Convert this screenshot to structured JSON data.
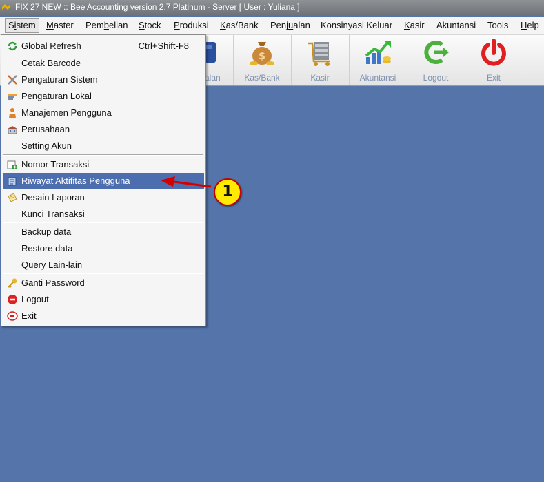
{
  "window": {
    "title": "FIX 27 NEW :: Bee Accounting version 2.7 Platinum - Server  [ User : Yuliana ]"
  },
  "menubar": {
    "items": [
      {
        "pre": "S",
        "u": "i",
        "post": "stem"
      },
      {
        "pre": "",
        "u": "M",
        "post": "aster"
      },
      {
        "pre": "Pem",
        "u": "b",
        "post": "elian"
      },
      {
        "pre": "",
        "u": "S",
        "post": "tock"
      },
      {
        "pre": "",
        "u": "P",
        "post": "roduksi"
      },
      {
        "pre": "",
        "u": "K",
        "post": "as/Bank"
      },
      {
        "pre": "Penj",
        "u": "u",
        "post": "alan"
      },
      {
        "pre": "Konsinyasi Keluar",
        "u": "",
        "post": ""
      },
      {
        "pre": "",
        "u": "K",
        "post": "asir"
      },
      {
        "pre": "Akuntansi",
        "u": "",
        "post": ""
      },
      {
        "pre": "Tools",
        "u": "",
        "post": ""
      },
      {
        "pre": "",
        "u": "H",
        "post": "elp"
      }
    ]
  },
  "toolbar": {
    "buttons": [
      {
        "label": "...ualan",
        "icon": "bag-icon"
      },
      {
        "label": "Kas/Bank",
        "icon": "money-bag-icon"
      },
      {
        "label": "Kasir",
        "icon": "cashier-cart-icon"
      },
      {
        "label": "Akuntansi",
        "icon": "chart-growth-icon"
      },
      {
        "label": "Logout",
        "icon": "logout-arrow-icon"
      },
      {
        "label": "Exit",
        "icon": "power-icon"
      }
    ]
  },
  "dropdown": {
    "groups": [
      [
        {
          "label": "Global Refresh",
          "shortcut": "Ctrl+Shift-F8",
          "icon": "refresh-icon"
        },
        {
          "label": "Cetak Barcode",
          "shortcut": "",
          "icon": ""
        },
        {
          "label": "Pengaturan Sistem",
          "shortcut": "",
          "icon": "tools-icon"
        },
        {
          "label": "Pengaturan Lokal",
          "shortcut": "",
          "icon": "pencil-icon"
        },
        {
          "label": "Manajemen Pengguna",
          "shortcut": "",
          "icon": "user-icon"
        },
        {
          "label": "Perusahaan",
          "shortcut": "",
          "icon": "building-icon"
        },
        {
          "label": "Setting Akun",
          "shortcut": "",
          "icon": ""
        }
      ],
      [
        {
          "label": "Nomor Transaksi",
          "shortcut": "",
          "icon": "add-document-icon"
        },
        {
          "label": "Riwayat Aktifitas Pengguna",
          "shortcut": "",
          "icon": "history-icon",
          "highlighted": true
        },
        {
          "label": "Desain Laporan",
          "shortcut": "",
          "icon": "report-design-icon"
        },
        {
          "label": "Kunci Transaksi",
          "shortcut": "",
          "icon": ""
        }
      ],
      [
        {
          "label": "Backup data",
          "shortcut": "",
          "icon": ""
        },
        {
          "label": "Restore data",
          "shortcut": "",
          "icon": ""
        },
        {
          "label": "Query Lain-lain",
          "shortcut": "",
          "icon": ""
        }
      ],
      [
        {
          "label": "Ganti Password",
          "shortcut": "",
          "icon": "key-icon"
        },
        {
          "label": "Logout",
          "shortcut": "",
          "icon": "logout-icon"
        },
        {
          "label": "Exit",
          "shortcut": "",
          "icon": "exit-icon"
        }
      ]
    ]
  },
  "annotation": {
    "callout_number": "1"
  },
  "colors": {
    "desktop": "#5574aa",
    "highlight": "#4d6eae",
    "callout_fill": "#ffea00",
    "arrow": "#d40000"
  }
}
